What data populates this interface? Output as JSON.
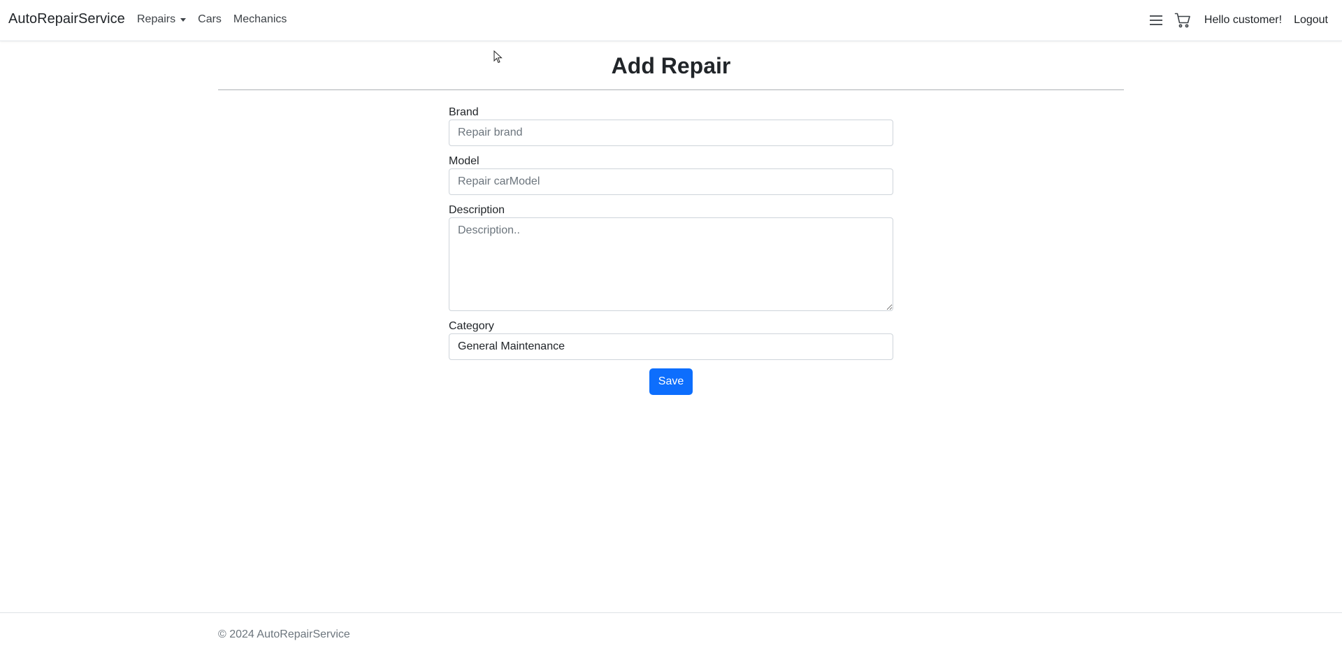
{
  "navbar": {
    "brand": "AutoRepairService",
    "links": [
      {
        "label": "Repairs",
        "has_dropdown": true
      },
      {
        "label": "Cars"
      },
      {
        "label": "Mechanics"
      }
    ],
    "menu_icon": "hamburger-icon",
    "cart_icon": "cart-icon",
    "greeting": "Hello customer!",
    "logout": "Logout"
  },
  "page": {
    "title": "Add Repair"
  },
  "form": {
    "brand": {
      "label": "Brand",
      "placeholder": "Repair brand",
      "value": ""
    },
    "model": {
      "label": "Model",
      "placeholder": "Repair carModel",
      "value": ""
    },
    "description": {
      "label": "Description",
      "placeholder": "Description..",
      "value": ""
    },
    "category": {
      "label": "Category",
      "value": "General Maintenance"
    },
    "save_label": "Save"
  },
  "footer": {
    "text": "© 2024 AutoRepairService"
  },
  "colors": {
    "accent": "#0d6efd",
    "progress": "#6aa000"
  }
}
